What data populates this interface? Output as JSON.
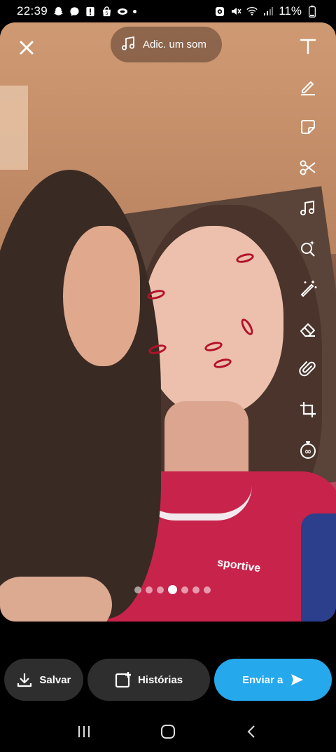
{
  "status_bar": {
    "time": "22:39",
    "battery": "11%",
    "left_icons": [
      "snapchat-icon",
      "messenger-icon",
      "alert-icon",
      "shopping-icon",
      "cloud-icon"
    ],
    "right_icons": [
      "alarm-icon",
      "mute-icon",
      "wifi-icon",
      "signal-icon",
      "battery-icon"
    ]
  },
  "editor": {
    "sound_label": "Adic. um som",
    "tools": [
      "text-tool-icon",
      "pen-tool-icon",
      "sticker-tool-icon",
      "scissors-tool-icon",
      "music-tool-icon",
      "lens-search-icon",
      "magic-wand-icon",
      "eraser-icon",
      "paperclip-icon",
      "crop-icon",
      "timer-icon"
    ],
    "pagination": {
      "count": 7,
      "active_index": 3
    }
  },
  "actions": {
    "save_label": "Salvar",
    "stories_label": "Histórias",
    "send_label": "Enviar a"
  },
  "photo_text": {
    "shirt_brand": "sportive"
  },
  "colors": {
    "send_button": "#25a8ec",
    "dark_button": "#2e2e2e",
    "sound_pill": "#5a3c2d"
  }
}
